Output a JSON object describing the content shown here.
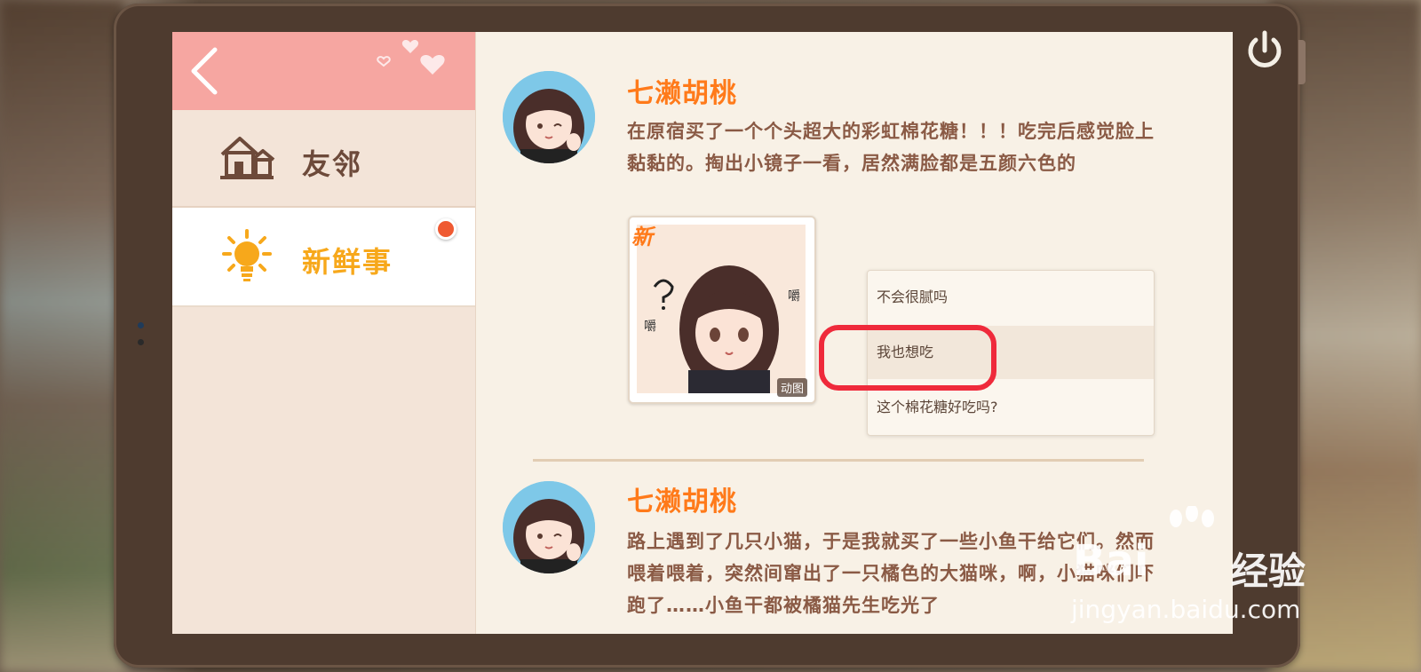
{
  "sidebar": {
    "back_label": "<",
    "items": [
      {
        "label": "友邻",
        "icon": "house-icon"
      },
      {
        "label": "新鲜事",
        "icon": "lightbulb-icon",
        "has_badge": true
      }
    ]
  },
  "posts": [
    {
      "author": "七濑胡桃",
      "text": "在原宿买了一个个头超大的彩虹棉花糖！！！吃完后感觉脸上黏黏的。掏出小镜子一看，居然满脸都是五颜六色的",
      "sticker": {
        "new_label": "新",
        "anim_label": "动图",
        "question": "?",
        "sound": "嚼"
      },
      "reply_options": [
        "不会很腻吗",
        "我也想吃",
        "这个棉花糖好吃吗?"
      ],
      "highlighted_option": "我也想吃"
    },
    {
      "author": "七濑胡桃",
      "text": "路上遇到了几只小猫，于是我就买了一些小鱼干给它们。然而喂着喂着，突然间窜出了一只橘色的大猫咪，啊，小猫咪们吓跑了……小鱼干都被橘猫先生吃光了"
    }
  ],
  "watermark": {
    "brand": "Bai",
    "brand_cn": "经验",
    "url": "jingyan.baidu.com"
  },
  "colors": {
    "accent": "#ff7a1a",
    "header_pink": "#f6a6a1",
    "highlight_box": "#ef2a3b",
    "nav_active": "#f7a81b"
  }
}
